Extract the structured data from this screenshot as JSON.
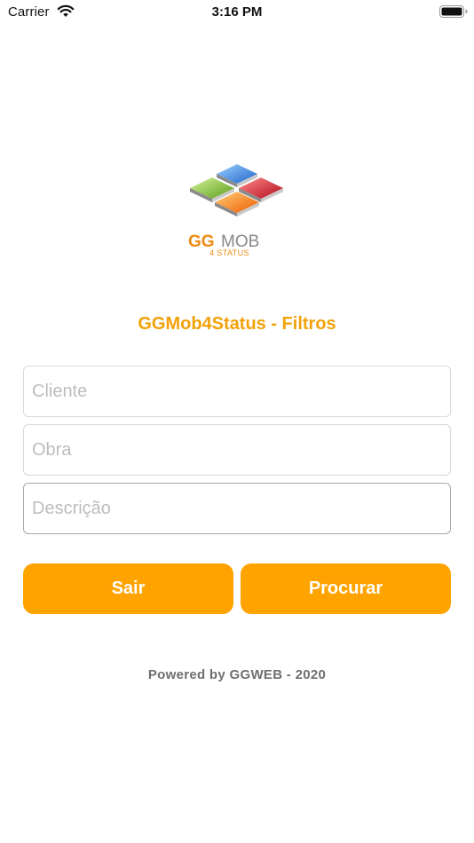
{
  "status_bar": {
    "carrier": "Carrier",
    "time": "3:16 PM",
    "wifi_icon": "wifi-icon",
    "battery_icon": "battery-icon"
  },
  "logo": {
    "wordmark": "GGMOB",
    "tagline": "4 STATUS"
  },
  "title": "GGMob4Status - Filtros",
  "form": {
    "cliente": {
      "placeholder": "Cliente",
      "value": ""
    },
    "obra": {
      "placeholder": "Obra",
      "value": ""
    },
    "descricao": {
      "placeholder": "Descrição",
      "value": ""
    }
  },
  "buttons": {
    "sair": "Sair",
    "procurar": "Procurar"
  },
  "footer": "Powered by GGWEB - 2020",
  "colors": {
    "accent": "#ffa300",
    "title": "#f2a20a",
    "footer": "#6f6f6f"
  }
}
